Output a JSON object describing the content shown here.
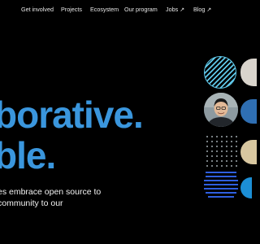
{
  "nav": {
    "items": [
      {
        "label": "Get involved"
      },
      {
        "label": "Projects"
      },
      {
        "label": "Ecosystem"
      },
      {
        "label": "Our program"
      },
      {
        "label": "Jobs",
        "arrow": "↗"
      },
      {
        "label": "Blog",
        "arrow": "↗"
      }
    ]
  },
  "hero": {
    "line1": "borative.",
    "line2": "ble.",
    "description": [
      "es embrace open source to",
      "community to our"
    ]
  },
  "icons": {
    "avatar": "person-avatar-photo",
    "stripes": "striped-circle-graphic",
    "dots": "dot-grid-graphic",
    "lines": "horizontal-lines-graphic"
  },
  "colors": {
    "background": "#000000",
    "accent": "#3a96dd",
    "stripe": "#5fc7e8",
    "lines": "#2f5fe0"
  }
}
